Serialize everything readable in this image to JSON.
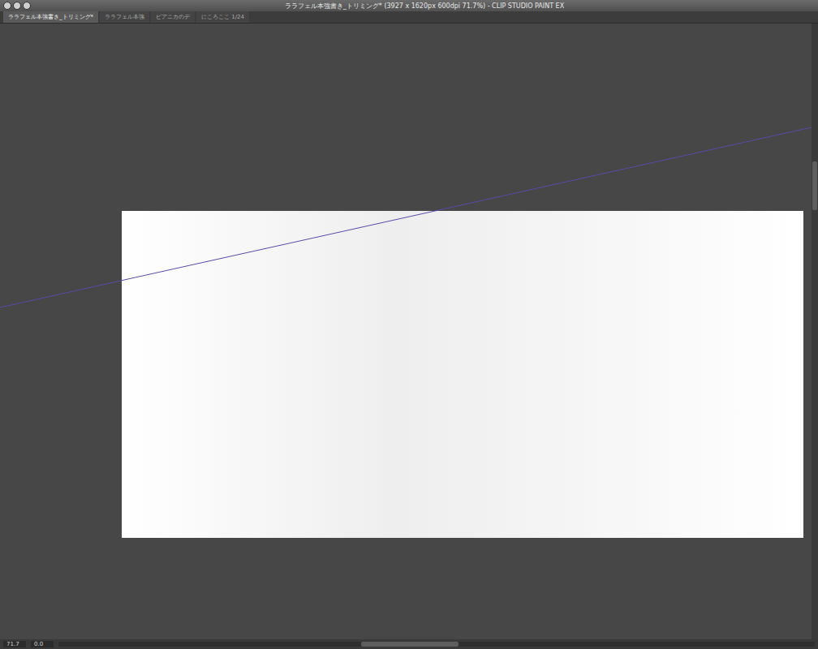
{
  "window": {
    "title": "ララフェル本強書き_トリミング* (3927 x 1620px 600dpi 71.7%) - CLIP STUDIO PAINT EX"
  },
  "tabs": [
    {
      "label": "ララフェル本強書き_トリミング*",
      "selected": true
    },
    {
      "label": "ララフェル本強",
      "selected": false
    },
    {
      "label": "ピアニカのデ",
      "selected": false
    },
    {
      "label": "にころここ 1/24",
      "selected": false
    }
  ],
  "status_bar": {
    "zoom": "71.7",
    "angle": "0.0"
  }
}
